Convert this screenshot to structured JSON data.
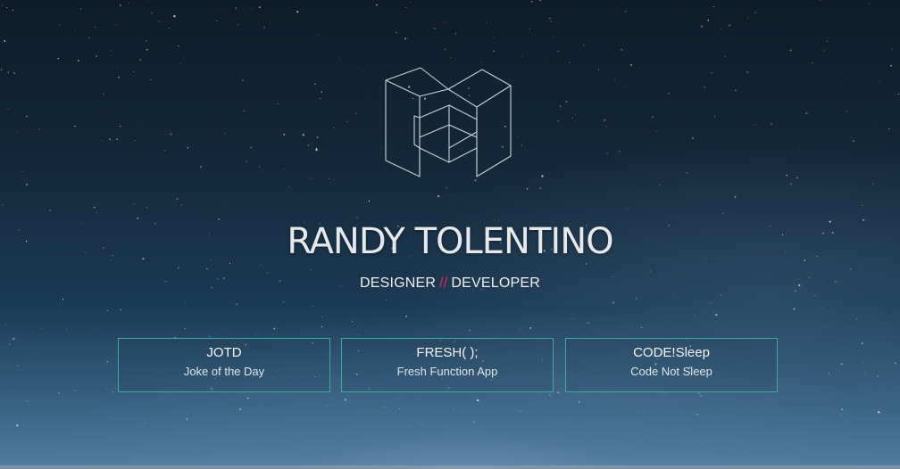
{
  "hero": {
    "title": "RANDY TOLENTINO",
    "subtitle_left": "DESIGNER",
    "subtitle_sep": "//",
    "subtitle_right": "DEVELOPER",
    "accent_color": "#e0245e",
    "border_color": "#3fa9a0"
  },
  "logo": {
    "icon": "geometric-m-logo-icon"
  },
  "cards": [
    {
      "title": "JOTD",
      "subtitle": "Joke of the Day"
    },
    {
      "title": "FRESH( );",
      "subtitle": "Fresh Function App"
    },
    {
      "title": "CODE!Sleep",
      "subtitle": "Code Not Sleep"
    }
  ]
}
